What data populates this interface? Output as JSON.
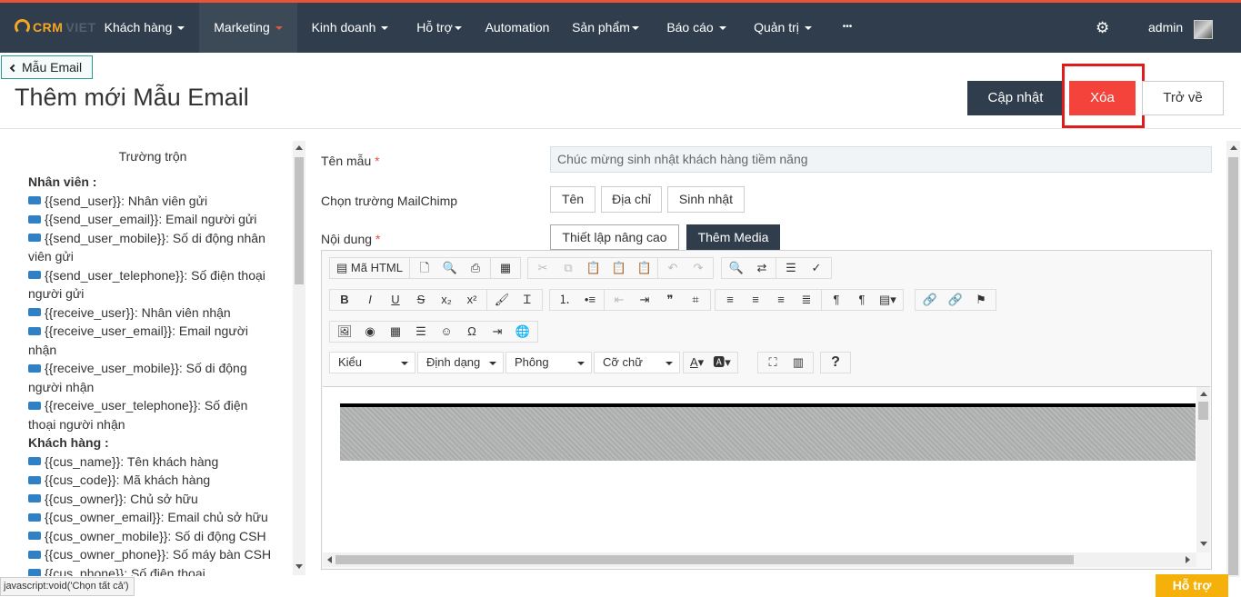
{
  "nav": {
    "logo_a": "CRM",
    "logo_b": "VIET",
    "items": [
      {
        "label": "Khách hàng"
      },
      {
        "label": "Marketing"
      },
      {
        "label": "Kinh doanh"
      },
      {
        "label": "Hỗ trợ"
      },
      {
        "label": "Automation"
      },
      {
        "label": "Sản phẩm"
      },
      {
        "label": "Báo cáo"
      },
      {
        "label": "Quản trị"
      },
      {
        "label": "•••"
      }
    ],
    "user": "admin",
    "gear_icon": "gear-icon"
  },
  "page": {
    "back_label": "Mẫu Email",
    "title": "Thêm mới Mẫu Email"
  },
  "actions": {
    "update": "Cập nhật",
    "delete": "Xóa",
    "back": "Trở về"
  },
  "merge_fields": {
    "title": "Trường trộn",
    "groups": [
      {
        "heading": "Nhân viên :",
        "items": [
          "{{send_user}}: Nhân viên gửi",
          "{{send_user_email}}: Email người gửi",
          "{{send_user_mobile}}: Số di động nhân viên gửi",
          "{{send_user_telephone}}: Số điện thoại người gửi",
          "{{receive_user}}: Nhân viên nhận",
          "{{receive_user_email}}: Email người nhận",
          "{{receive_user_mobile}}: Số di động người nhận",
          "{{receive_user_telephone}}: Số điện thoại người nhận"
        ]
      },
      {
        "heading": "Khách hàng :",
        "items": [
          "{{cus_name}}: Tên khách hàng",
          "{{cus_code}}: Mã khách hàng",
          "{{cus_owner}}: Chủ sở hữu",
          "{{cus_owner_email}}: Email chủ sở hữu",
          "{{cus_owner_mobile}}: Số di động CSH",
          "{{cus_owner_phone}}: Số máy bàn CSH",
          "{{cus_phone}}: Số điện thoại"
        ]
      }
    ]
  },
  "form": {
    "name_label": "Tên mẫu",
    "required": "*",
    "name_value": "Chúc mừng sinh nhật khách hàng tiềm năng",
    "mailchimp_label": "Chọn trường MailChimp",
    "mailchimp_buttons": [
      "Tên",
      "Địa chỉ",
      "Sinh nhật"
    ],
    "content_label": "Nội dung",
    "advanced_button": "Thiết lập nâng cao",
    "media_button": "Thêm Media"
  },
  "editor": {
    "source_label": "Mã HTML",
    "combos": [
      "Kiểu",
      "Định dạng",
      "Phông",
      "Cỡ chữ"
    ],
    "toolbar_text": {
      "bold": "B",
      "italic": "I",
      "underline": "U",
      "strike": "S",
      "help": "?",
      "omega": "Ω"
    }
  },
  "status_text": "javascript:void('Chọn tất cả')",
  "support_label": "Hỗ trợ"
}
